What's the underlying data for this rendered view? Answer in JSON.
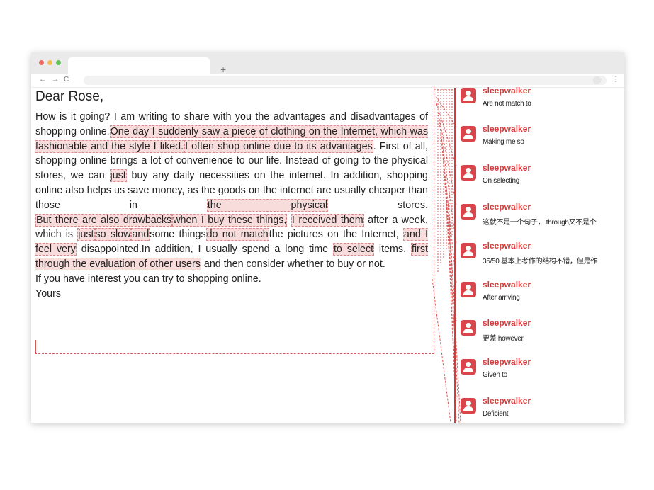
{
  "browser": {
    "new_tab": "+",
    "nav": {
      "back": "←",
      "forward": "→",
      "reload": "C"
    },
    "star": "☆",
    "menu": "⋮",
    "dot_colors": [
      "#ee6a5f",
      "#f5bd4f",
      "#61c454"
    ]
  },
  "essay": {
    "greeting": "Dear Rose,",
    "p1": {
      "a": "How is it going? I am writing to share with you the advantages and disadvantages of shopping online.",
      "h1": "One day I suddenly saw a piece of clothing on the Internet, which was fashionable and the style I liked.",
      "h2": "I often shop online due to its advantages",
      "b": ". First of all, shopping online brings a lot of convenience to our life. Instead of going to the physical stores, we can",
      "h3": "just",
      "c": "buy any daily necessities on the internet. In addition, shopping online also helps us save money, as the goods on the internet are usually cheaper than those in",
      "h4": "the physical",
      "d": "stores."
    },
    "p2": {
      "h1": "But there are also drawbacks",
      "h2": "when I buy these things,",
      "h3": "I received them",
      "a": "after a week, which is",
      "h4": "just",
      "h5": "so slow",
      "h6": "and",
      "b": "some things",
      "h7": "do not match",
      "c": "the pictures on the Internet,",
      "h8": "and I feel very",
      "d": "disappointed.In addition, I usually spend a long time",
      "h9": "to select",
      "e": "items,",
      "h10": "first through the evaluation of other users",
      "f": "and then consider whether to buy or not."
    },
    "p3": "If you have interest you can try to shopping online.",
    "p4": "Yours"
  },
  "comments": [
    {
      "user": "sleepwalker",
      "text": "Are not match to"
    },
    {
      "user": "sleepwalker",
      "text": "Making me so"
    },
    {
      "user": "sleepwalker",
      "text": "On selecting"
    },
    {
      "user": "sleepwalker",
      "text": "这就不是一个句子， through又不是个"
    },
    {
      "user": "sleepwalker",
      "text": "35/50  基本上考作的结构不错，但是作"
    },
    {
      "user": "sleepwalker",
      "text": "After arriving"
    },
    {
      "user": "sleepwalker",
      "text": "更差 however,"
    },
    {
      "user": "sleepwalker",
      "text": "Given to"
    },
    {
      "user": "sleepwalker",
      "text": "Deficient"
    }
  ],
  "colors": {
    "accent": "#d53b3b",
    "highlight": "#f8dcdc"
  }
}
